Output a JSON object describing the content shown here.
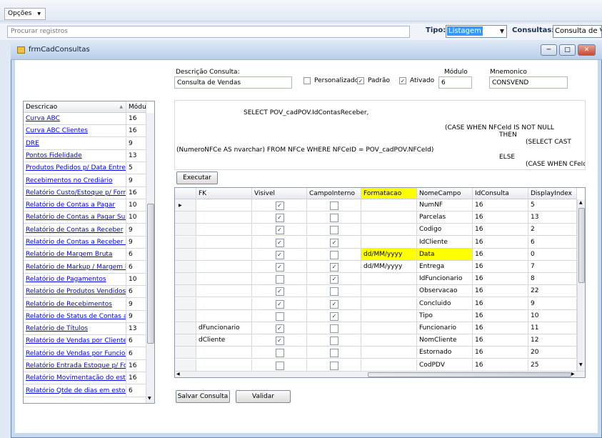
{
  "menu": {
    "opcoes_label": "Opções",
    "arrow": "▼"
  },
  "search": {
    "placeholder": "Procurar registros"
  },
  "tipo": {
    "label": "Tipo:",
    "value": "Listagem"
  },
  "consultas": {
    "label": "Consultas:",
    "value": "Consulta de Ve"
  },
  "window": {
    "title": "frmCadConsultas",
    "min": "─",
    "max": "□",
    "close": "✕"
  },
  "form": {
    "descricao_label": "Descrição Consulta:",
    "descricao_value": "Consulta de Vendas",
    "personalizado_label": "Personalizado",
    "personalizado_checked": false,
    "padrao_label": "Padrão",
    "padrao_checked": true,
    "ativado_label": "Ativado",
    "ativado_checked": true,
    "modulo_label": "Módulo",
    "modulo_value": "6",
    "mnemonico_label": "Mnemonico",
    "mnemonico_value": "CONSVEND"
  },
  "sql_lines": [
    "SELECT POV_cadPOV.IdContasReceber,",
    "(CASE WHEN NFCeId IS NOT NULL",
    "THEN",
    "(SELECT CAST",
    "(NumeroNFCe AS nvarchar) FROM NFCe WHERE NFCeID = POV_cadPOV.NFCeId)",
    "ELSE",
    "(CASE WHEN CFeId"
  ],
  "buttons": {
    "executar": "Executar",
    "salvar": "Salvar Consulta",
    "validar": "Validar"
  },
  "list": {
    "headers": [
      "Descricao",
      "Módulo"
    ],
    "sort_icon": "▲",
    "rows": [
      {
        "descricao": "Curva ABC",
        "modulo": "16"
      },
      {
        "descricao": "Curva ABC Clientes",
        "modulo": "16"
      },
      {
        "descricao": "DRE",
        "modulo": "9"
      },
      {
        "descricao": "Pontos Fidelidade",
        "modulo": "13"
      },
      {
        "descricao": "Produtos Pedidos p/ Data Entrega",
        "modulo": "5"
      },
      {
        "descricao": "Recebimentos no Crediário",
        "modulo": "9"
      },
      {
        "descricao": "Relatório Custo/Estoque p/ Forne...",
        "modulo": "16"
      },
      {
        "descricao": "Relatório de Contas a Pagar",
        "modulo": "10"
      },
      {
        "descricao": "Relatório de Contas a Pagar Sum...",
        "modulo": "10"
      },
      {
        "descricao": "Relatório de Contas a Receber",
        "modulo": "9"
      },
      {
        "descricao": "Relatório de Contas a Receber S...",
        "modulo": "9"
      },
      {
        "descricao": "Relatório de Margem Bruta",
        "modulo": "6"
      },
      {
        "descricao": "Relatório de Markup / Margem Br...",
        "modulo": "6"
      },
      {
        "descricao": "Relatório de Pagamentos",
        "modulo": "10"
      },
      {
        "descricao": "Relatório de Produtos Vendidos",
        "modulo": "6"
      },
      {
        "descricao": "Relatório de Recebimentos",
        "modulo": "9"
      },
      {
        "descricao": "Relatório de Status de Contas a ...",
        "modulo": "9"
      },
      {
        "descricao": "Relatório de Títulos",
        "modulo": "13"
      },
      {
        "descricao": "Relatório de Vendas por Cliente/F...",
        "modulo": "6"
      },
      {
        "descricao": "Relatório de Vendas por Funcion...",
        "modulo": "6"
      },
      {
        "descricao": "Relatório Entrada Estoque p/ For...",
        "modulo": "16"
      },
      {
        "descricao": "Relatório Movimentação do estoq...",
        "modulo": "16"
      },
      {
        "descricao": "Relatório Qtde de dias em estoque",
        "modulo": "6"
      }
    ]
  },
  "grid": {
    "headers": [
      "FK",
      "Visivel",
      "CampoInterno",
      "Formatacao",
      "NomeCampo",
      "IdConsulta",
      "DisplayIndex"
    ],
    "current_row_icon": "▶",
    "rows": [
      {
        "fk": "",
        "visivel": true,
        "interno": false,
        "formatacao": "",
        "nome": "NumNF",
        "id": "16",
        "idx": "5"
      },
      {
        "fk": "",
        "visivel": true,
        "interno": false,
        "formatacao": "",
        "nome": "Parcelas",
        "id": "16",
        "idx": "13"
      },
      {
        "fk": "",
        "visivel": true,
        "interno": false,
        "formatacao": "",
        "nome": "Codigo",
        "id": "16",
        "idx": "2"
      },
      {
        "fk": "",
        "visivel": true,
        "interno": true,
        "formatacao": "",
        "nome": "IdCliente",
        "id": "16",
        "idx": "6"
      },
      {
        "fk": "",
        "visivel": true,
        "interno": false,
        "formatacao": "dd/MM/yyyy",
        "nome": "Data",
        "id": "16",
        "idx": "0"
      },
      {
        "fk": "",
        "visivel": true,
        "interno": true,
        "formatacao": "dd/MM/yyyy",
        "nome": "Entrega",
        "id": "16",
        "idx": "7"
      },
      {
        "fk": "",
        "visivel": false,
        "interno": true,
        "formatacao": "",
        "nome": "IdFuncionario",
        "id": "16",
        "idx": "8"
      },
      {
        "fk": "",
        "visivel": true,
        "interno": false,
        "formatacao": "",
        "nome": "Observacao",
        "id": "16",
        "idx": "22"
      },
      {
        "fk": "",
        "visivel": true,
        "interno": true,
        "formatacao": "",
        "nome": "Concluido",
        "id": "16",
        "idx": "9"
      },
      {
        "fk": "",
        "visivel": false,
        "interno": true,
        "formatacao": "",
        "nome": "Tipo",
        "id": "16",
        "idx": "10"
      },
      {
        "fk": "dFuncionario",
        "visivel": true,
        "interno": false,
        "formatacao": "",
        "nome": "Funcionario",
        "id": "16",
        "idx": "11"
      },
      {
        "fk": "dCliente",
        "visivel": true,
        "interno": false,
        "formatacao": "",
        "nome": "NomCliente",
        "id": "16",
        "idx": "12"
      },
      {
        "fk": "",
        "visivel": false,
        "interno": false,
        "formatacao": "",
        "nome": "Estornado",
        "id": "16",
        "idx": "20"
      },
      {
        "fk": "",
        "visivel": false,
        "interno": false,
        "formatacao": "",
        "nome": "CodPDV",
        "id": "16",
        "idx": "25"
      }
    ]
  },
  "check_mark": "✓",
  "highlight_color": "#ffff00"
}
